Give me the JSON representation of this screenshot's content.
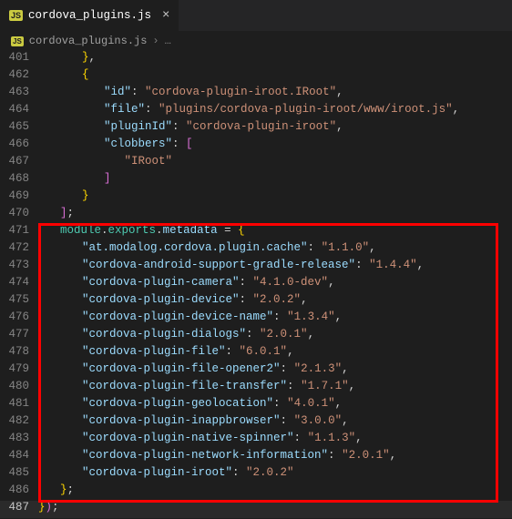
{
  "tab": {
    "badge": "JS",
    "title": "cordova_plugins.js",
    "close": "×"
  },
  "breadcrumb": {
    "file": "cordova_plugins.js",
    "chev": "›",
    "more": "…"
  },
  "lines": {
    "l401": "401",
    "l401_t1": "}",
    "l401_t2": ",",
    "l462": "462",
    "l462_t1": "{",
    "l463": "463",
    "l463_k": "\"id\"",
    "l463_c": ":",
    "l463_v": "\"cordova-plugin-iroot.IRoot\"",
    "l463_e": ",",
    "l464": "464",
    "l464_k": "\"file\"",
    "l464_c": ":",
    "l464_v": "\"plugins/cordova-plugin-iroot/www/iroot.js\"",
    "l464_e": ",",
    "l465": "465",
    "l465_k": "\"pluginId\"",
    "l465_c": ":",
    "l465_v": "\"cordova-plugin-iroot\"",
    "l465_e": ",",
    "l466": "466",
    "l466_k": "\"clobbers\"",
    "l466_c": ":",
    "l466_b": " [",
    "l467": "467",
    "l467_v": "\"IRoot\"",
    "l468": "468",
    "l468_b": "]",
    "l469": "469",
    "l469_b": "}",
    "l470": "470",
    "l470_b": "]",
    "l470_e": ";",
    "l471": "471",
    "l471_a": "module",
    "l471_d1": ".",
    "l471_b": "exports",
    "l471_d2": ".",
    "l471_c": "metadata",
    "l471_eq": " = ",
    "l471_o": "{",
    "l472": "472",
    "l473": "473",
    "l474": "474",
    "l475": "475",
    "l476": "476",
    "l477": "477",
    "l478": "478",
    "l479": "479",
    "l480": "480",
    "l481": "481",
    "l482": "482",
    "l483": "483",
    "l484": "484",
    "l485": "485",
    "l486": "486",
    "l486_b": "}",
    "l486_e": ";",
    "l487": "487",
    "l487_a": "}",
    "l487_b": ")",
    "l487_e": ";"
  },
  "meta": [
    {
      "k": "\"at.modalog.cordova.plugin.cache\"",
      "v": "\"1.1.0\""
    },
    {
      "k": "\"cordova-android-support-gradle-release\"",
      "v": "\"1.4.4\""
    },
    {
      "k": "\"cordova-plugin-camera\"",
      "v": "\"4.1.0-dev\""
    },
    {
      "k": "\"cordova-plugin-device\"",
      "v": "\"2.0.2\""
    },
    {
      "k": "\"cordova-plugin-device-name\"",
      "v": "\"1.3.4\""
    },
    {
      "k": "\"cordova-plugin-dialogs\"",
      "v": "\"2.0.1\""
    },
    {
      "k": "\"cordova-plugin-file\"",
      "v": "\"6.0.1\""
    },
    {
      "k": "\"cordova-plugin-file-opener2\"",
      "v": "\"2.1.3\""
    },
    {
      "k": "\"cordova-plugin-file-transfer\"",
      "v": "\"1.7.1\""
    },
    {
      "k": "\"cordova-plugin-geolocation\"",
      "v": "\"4.0.1\""
    },
    {
      "k": "\"cordova-plugin-inappbrowser\"",
      "v": "\"3.0.0\""
    },
    {
      "k": "\"cordova-plugin-native-spinner\"",
      "v": "\"1.1.3\""
    },
    {
      "k": "\"cordova-plugin-network-information\"",
      "v": "\"2.0.1\""
    },
    {
      "k": "\"cordova-plugin-iroot\"",
      "v": "\"2.0.2\""
    }
  ],
  "sep": ": ",
  "comma": ","
}
